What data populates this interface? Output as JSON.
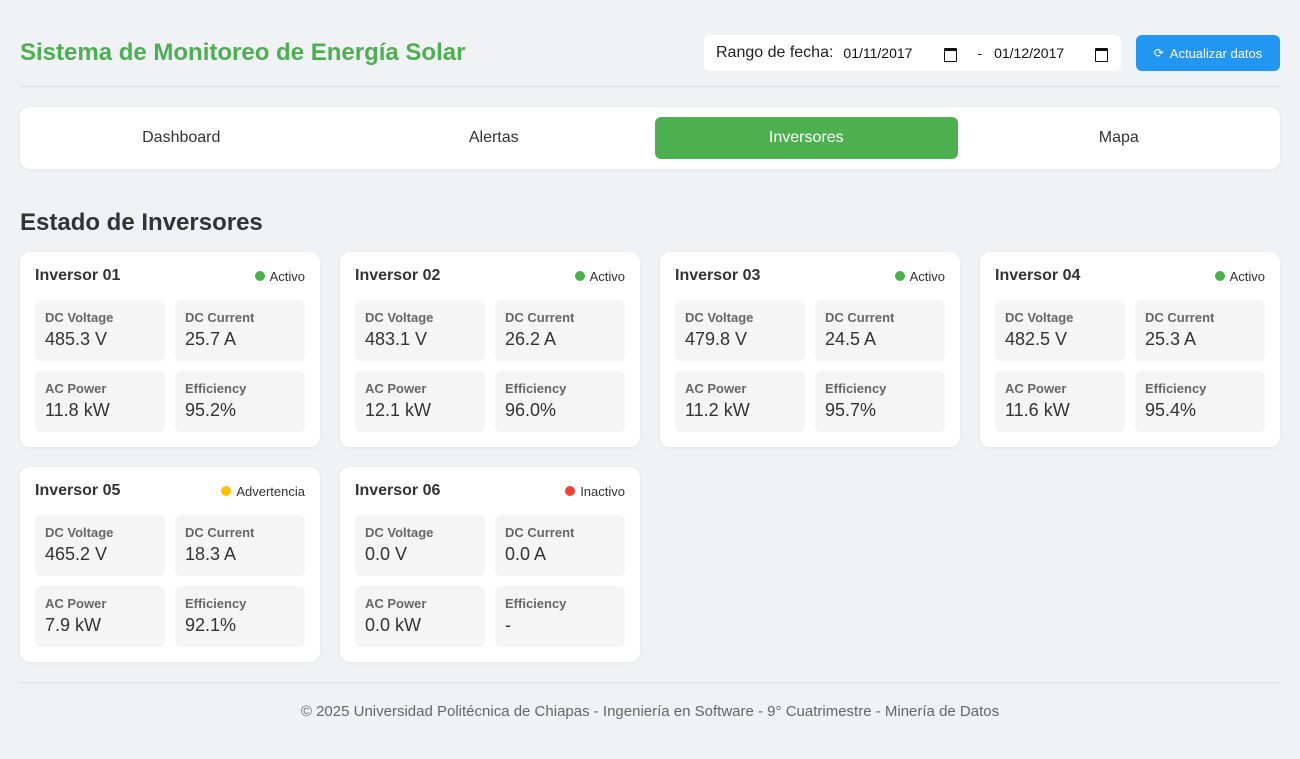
{
  "header": {
    "title": "Sistema de Monitoreo de Energía Solar",
    "date_range_label": "Rango de fecha:",
    "date_from": "01/11/2017",
    "date_to": "01/12/2017",
    "separator": "-",
    "refresh_icon": "⟳",
    "refresh_label": "Actualizar datos"
  },
  "tabs": [
    {
      "label": "Dashboard",
      "active": false
    },
    {
      "label": "Alertas",
      "active": false
    },
    {
      "label": "Inversores",
      "active": true
    },
    {
      "label": "Mapa",
      "active": false
    }
  ],
  "section_title": "Estado de Inversores",
  "status_colors": {
    "Activo": "#4caf50",
    "Advertencia": "#ffc107",
    "Inactivo": "#f44336"
  },
  "inverters": [
    {
      "name": "Inversor 01",
      "status": "Activo",
      "metrics": [
        {
          "label": "DC Voltage",
          "value": "485.3 V"
        },
        {
          "label": "DC Current",
          "value": "25.7 A"
        },
        {
          "label": "AC Power",
          "value": "11.8 kW"
        },
        {
          "label": "Efficiency",
          "value": "95.2%"
        }
      ]
    },
    {
      "name": "Inversor 02",
      "status": "Activo",
      "metrics": [
        {
          "label": "DC Voltage",
          "value": "483.1 V"
        },
        {
          "label": "DC Current",
          "value": "26.2 A"
        },
        {
          "label": "AC Power",
          "value": "12.1 kW"
        },
        {
          "label": "Efficiency",
          "value": "96.0%"
        }
      ]
    },
    {
      "name": "Inversor 03",
      "status": "Activo",
      "metrics": [
        {
          "label": "DC Voltage",
          "value": "479.8 V"
        },
        {
          "label": "DC Current",
          "value": "24.5 A"
        },
        {
          "label": "AC Power",
          "value": "11.2 kW"
        },
        {
          "label": "Efficiency",
          "value": "95.7%"
        }
      ]
    },
    {
      "name": "Inversor 04",
      "status": "Activo",
      "metrics": [
        {
          "label": "DC Voltage",
          "value": "482.5 V"
        },
        {
          "label": "DC Current",
          "value": "25.3 A"
        },
        {
          "label": "AC Power",
          "value": "11.6 kW"
        },
        {
          "label": "Efficiency",
          "value": "95.4%"
        }
      ]
    },
    {
      "name": "Inversor 05",
      "status": "Advertencia",
      "metrics": [
        {
          "label": "DC Voltage",
          "value": "465.2 V"
        },
        {
          "label": "DC Current",
          "value": "18.3 A"
        },
        {
          "label": "AC Power",
          "value": "7.9 kW"
        },
        {
          "label": "Efficiency",
          "value": "92.1%"
        }
      ]
    },
    {
      "name": "Inversor 06",
      "status": "Inactivo",
      "metrics": [
        {
          "label": "DC Voltage",
          "value": "0.0 V"
        },
        {
          "label": "DC Current",
          "value": "0.0 A"
        },
        {
          "label": "AC Power",
          "value": "0.0 kW"
        },
        {
          "label": "Efficiency",
          "value": "-"
        }
      ]
    }
  ],
  "footer": "© 2025 Universidad Politécnica de Chiapas - Ingeniería en Software - 9° Cuatrimestre - Minería de Datos"
}
